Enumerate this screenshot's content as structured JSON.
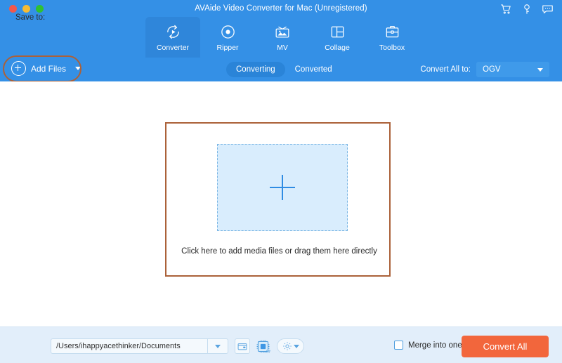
{
  "window": {
    "title": "AVAide Video Converter for Mac (Unregistered)",
    "traffic_lights": [
      {
        "name": "close",
        "color": "#f2574b"
      },
      {
        "name": "minimize",
        "color": "#f6bb33"
      },
      {
        "name": "maximize",
        "color": "#2fc131"
      }
    ],
    "actions": [
      {
        "icon": "cart-icon",
        "label": "Buy"
      },
      {
        "icon": "key-icon",
        "label": "Register"
      },
      {
        "icon": "feedback-icon",
        "label": "Feedback"
      }
    ]
  },
  "nav": {
    "tabs": [
      {
        "id": "converter",
        "label": "Converter",
        "icon": "converter-icon",
        "active": true
      },
      {
        "id": "ripper",
        "label": "Ripper",
        "icon": "ripper-icon",
        "active": false
      },
      {
        "id": "mv",
        "label": "MV",
        "icon": "mv-icon",
        "active": false
      },
      {
        "id": "collage",
        "label": "Collage",
        "icon": "collage-icon",
        "active": false
      },
      {
        "id": "toolbox",
        "label": "Toolbox",
        "icon": "toolbox-icon",
        "active": false
      }
    ]
  },
  "toolbar": {
    "add_files_label": "Add Files",
    "add_files_icon": "plus-circle-icon",
    "add_files_caret": "chevron-down-icon",
    "segments": [
      {
        "id": "converting",
        "label": "Converting",
        "active": true
      },
      {
        "id": "converted",
        "label": "Converted",
        "active": false
      }
    ],
    "convert_all_to_label": "Convert All to:",
    "convert_all_to_value": "OGV"
  },
  "main": {
    "dropzone_hint": "Click here to add media files or drag them here directly",
    "dropzone_plus_icon": "plus-icon"
  },
  "bottom": {
    "save_to_label": "Save to:",
    "save_to_path": "/Users/ihappyacethinker/Documents",
    "save_to_placeholder": "/Users/ihappyacethinker/Documents",
    "folder_icon": "folder-icon",
    "gpu_icon": "gpu-acceleration-icon",
    "gpu_state": "ON",
    "gear_icon": "gear-icon",
    "gear_caret": "chevron-down-icon",
    "merge_label": "Merge into one file",
    "merge_checked": false,
    "convert_all_label": "Convert All"
  },
  "colors": {
    "header_blue": "#3490e6",
    "active_tab_blue": "#2f86da",
    "highlight_ring": "#ab6139",
    "dropzone_fill": "#d9edfd",
    "dropzone_dash": "#7bb6e4",
    "bottom_bar": "#e2eefa",
    "convert_button": "#f2663c"
  }
}
